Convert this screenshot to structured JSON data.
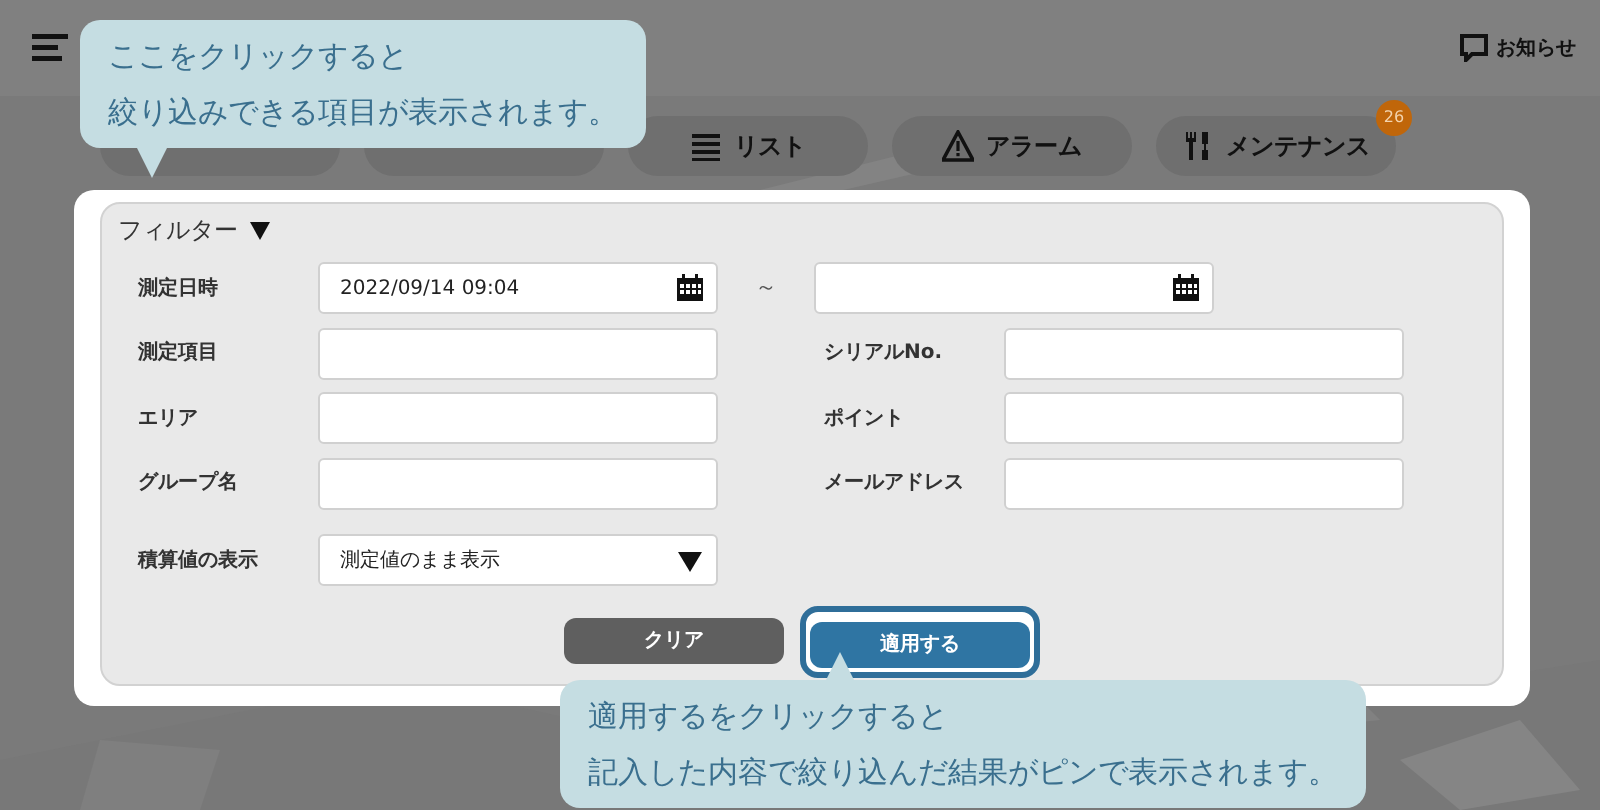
{
  "header": {
    "notice_label": "お知らせ"
  },
  "tabs": [
    {
      "kind": "covered"
    },
    {
      "kind": "covered"
    },
    {
      "kind": "list",
      "label": "リスト"
    },
    {
      "kind": "alarm",
      "label": "アラーム"
    },
    {
      "kind": "tools",
      "label": "メンテナンス",
      "badge": "26"
    }
  ],
  "filter": {
    "title": "フィルター",
    "expanded": true,
    "date": {
      "label": "測定日時",
      "from": "2022/09/14 09:04",
      "separator": "～"
    },
    "left_fields": [
      {
        "label": "測定項目"
      },
      {
        "label": "エリア"
      },
      {
        "label": "グループ名"
      }
    ],
    "right_fields": [
      {
        "label": "シリアルNo."
      },
      {
        "label": "ポイント"
      },
      {
        "label": "メールアドレス"
      }
    ],
    "aggregate": {
      "label": "積算値の表示",
      "value": "測定値のまま表示"
    },
    "buttons": [
      {
        "label": "クリア",
        "kind": "secondary",
        "highlighted": false
      },
      {
        "label": "適用する",
        "kind": "primary",
        "highlighted": true
      }
    ]
  },
  "callouts": [
    {
      "lines": [
        "ここをクリックすると",
        "絞り込みできる項目が表示されます。"
      ],
      "kind": "tip-down"
    },
    {
      "lines": [
        "適用するをクリックすると",
        "記入した内容で絞り込んだ結果がピンで表示されます。"
      ],
      "kind": "tip-up"
    }
  ]
}
